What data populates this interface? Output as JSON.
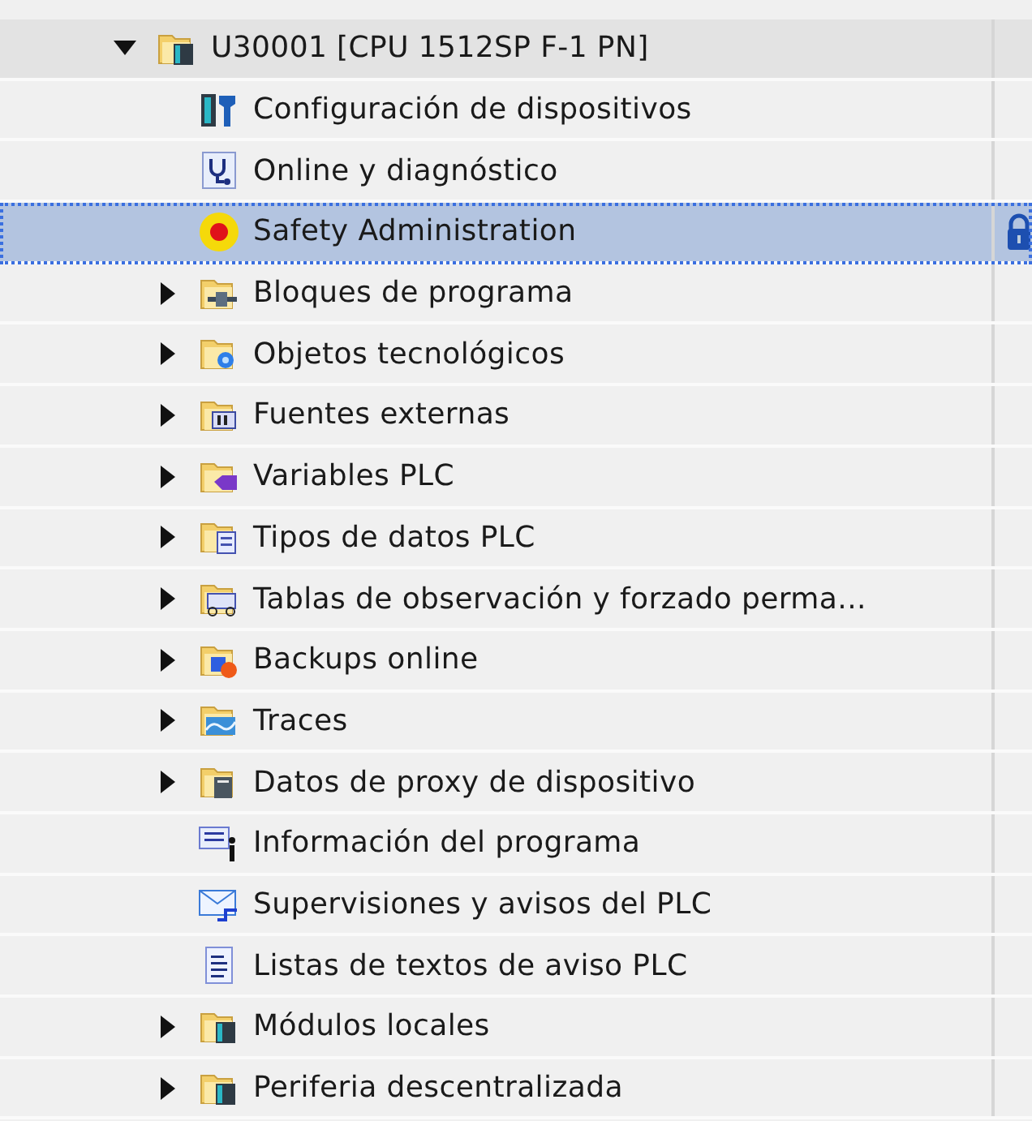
{
  "tree": {
    "label": "U30001 [CPU 1512SP F-1 PN]",
    "expanded": true,
    "selected": false,
    "children": [
      {
        "label": "Configuración de dispositivos",
        "expandable": false,
        "selected": false
      },
      {
        "label": "Online y diagnóstico",
        "expandable": false,
        "selected": false
      },
      {
        "label": "Safety Administration",
        "expandable": false,
        "selected": true,
        "locked": true
      },
      {
        "label": "Bloques de programa",
        "expandable": true,
        "selected": false
      },
      {
        "label": "Objetos tecnológicos",
        "expandable": true,
        "selected": false
      },
      {
        "label": "Fuentes externas",
        "expandable": true,
        "selected": false
      },
      {
        "label": "Variables PLC",
        "expandable": true,
        "selected": false
      },
      {
        "label": "Tipos de datos PLC",
        "expandable": true,
        "selected": false
      },
      {
        "label": "Tablas de observación y forzado perma...",
        "expandable": true,
        "selected": false
      },
      {
        "label": "Backups online",
        "expandable": true,
        "selected": false
      },
      {
        "label": "Traces",
        "expandable": true,
        "selected": false
      },
      {
        "label": "Datos de proxy de dispositivo",
        "expandable": true,
        "selected": false
      },
      {
        "label": "Información del programa",
        "expandable": false,
        "selected": false
      },
      {
        "label": "Supervisiones y avisos del PLC",
        "expandable": false,
        "selected": false
      },
      {
        "label": "Listas de textos de aviso PLC",
        "expandable": false,
        "selected": false
      },
      {
        "label": "Módulos locales",
        "expandable": true,
        "selected": false
      },
      {
        "label": "Periferia descentralizada",
        "expandable": true,
        "selected": false
      }
    ]
  }
}
